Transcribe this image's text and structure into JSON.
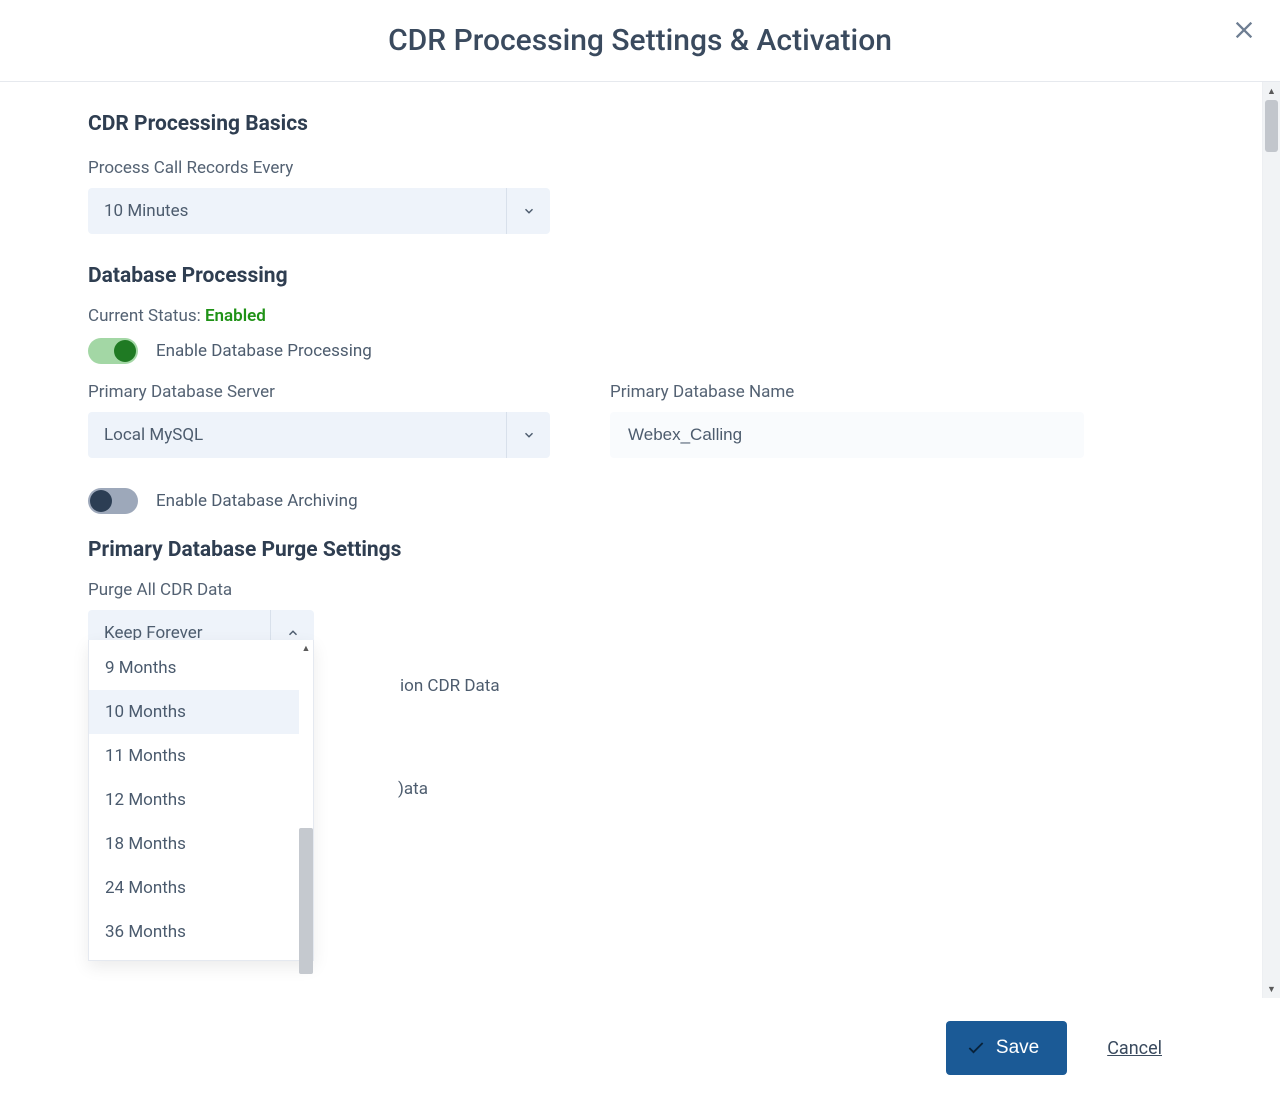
{
  "dialog": {
    "title": "CDR Processing Settings & Activation"
  },
  "basics": {
    "heading": "CDR Processing Basics",
    "process_every_label": "Process Call Records Every",
    "process_every_value": "10 Minutes"
  },
  "db": {
    "heading": "Database Processing",
    "status_label": "Current Status:",
    "status_value": "Enabled",
    "enable_processing_label": "Enable Database Processing",
    "enable_processing_on": true,
    "primary_server_label": "Primary Database Server",
    "primary_server_value": "Local MySQL",
    "primary_name_label": "Primary Database Name",
    "primary_name_value": "Webex_Calling",
    "enable_archiving_label": "Enable Database Archiving",
    "enable_archiving_on": false
  },
  "purge": {
    "heading": "Primary Database Purge Settings",
    "purge_all_label": "Purge All CDR Data",
    "selected_value": "Keep Forever",
    "options": [
      "9 Months",
      "10 Months",
      "11 Months",
      "12 Months",
      "18 Months",
      "24 Months",
      "36 Months"
    ],
    "highlighted_index": 1,
    "peek_text_1": "ion CDR Data",
    "peek_text_2": ")ata"
  },
  "footer": {
    "save_label": "Save",
    "cancel_label": "Cancel"
  }
}
